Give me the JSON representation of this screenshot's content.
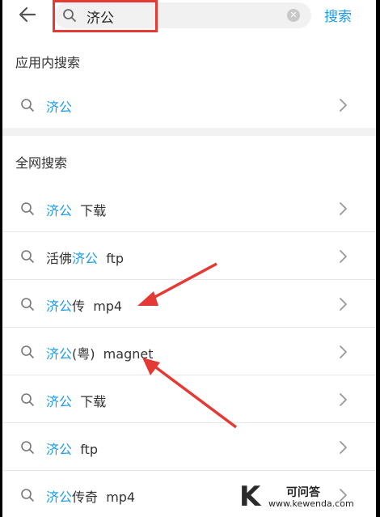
{
  "topbar": {
    "query": "济公",
    "search_action": "搜索"
  },
  "sections": {
    "in_app_title": "应用内搜索",
    "web_title": "全网搜索"
  },
  "in_app_results": [
    {
      "hl": "济公",
      "pre": "",
      "post": ""
    }
  ],
  "web_results": [
    {
      "pre": "",
      "hl": "济公",
      "post": "  下载"
    },
    {
      "pre": "活佛",
      "hl": "济公",
      "post": "  ftp"
    },
    {
      "pre": "",
      "hl": "济公",
      "post": "传  mp4"
    },
    {
      "pre": "",
      "hl": "济公",
      "post": "(粤)  magnet"
    },
    {
      "pre": "",
      "hl": "济公",
      "post": "  下载"
    },
    {
      "pre": "",
      "hl": "济公",
      "post": "  ftp"
    },
    {
      "pre": "",
      "hl": "济公",
      "post": "传奇  mp4"
    }
  ],
  "watermark": {
    "logo_letter": "K",
    "site_name": "可问答",
    "site_url": "www.kewenda.com"
  },
  "colors": {
    "highlight": "#1e9be6",
    "annotation": "#e53935"
  },
  "icons": [
    "back-arrow-icon",
    "search-icon",
    "clear-icon",
    "chevron-right-icon"
  ]
}
